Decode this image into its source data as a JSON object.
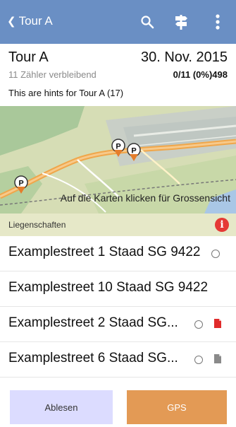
{
  "appbar": {
    "back_label": "Tour A",
    "icons": [
      "search-icon",
      "signpost-icon",
      "more-vert-icon"
    ],
    "background": "#6a8fc4"
  },
  "header": {
    "title": "Tour A",
    "date": "30. Nov. 2015",
    "remaining": "11 Zähler verbleibend",
    "counter": "0/11 (0%)498",
    "hints": "This are hints for Tour A (17)"
  },
  "map": {
    "caption": "Auf die Karten klicken für Grossensicht",
    "marker_label": "P"
  },
  "section": {
    "label": "Liegenschaften",
    "info_label": "i",
    "background": "#e6e8c8"
  },
  "list": [
    {
      "text": "Examplestreet 1 Staad SG 9422",
      "status_icon": "circle-outline-icon",
      "doc_icon": ""
    },
    {
      "text": "Examplestreet 10 Staad SG 9422",
      "status_icon": "",
      "doc_icon": ""
    },
    {
      "text": "Examplestreet 2 Staad SG...",
      "status_icon": "circle-outline-icon",
      "doc_icon": "document-red-icon"
    },
    {
      "text": "Examplestreet 6 Staad SG...",
      "status_icon": "circle-outline-icon",
      "doc_icon": "document-grey-icon"
    }
  ],
  "footer": {
    "read_label": "Ablesen",
    "gps_label": "GPS",
    "read_color": "#dcdcff",
    "gps_color": "#e39a55"
  }
}
